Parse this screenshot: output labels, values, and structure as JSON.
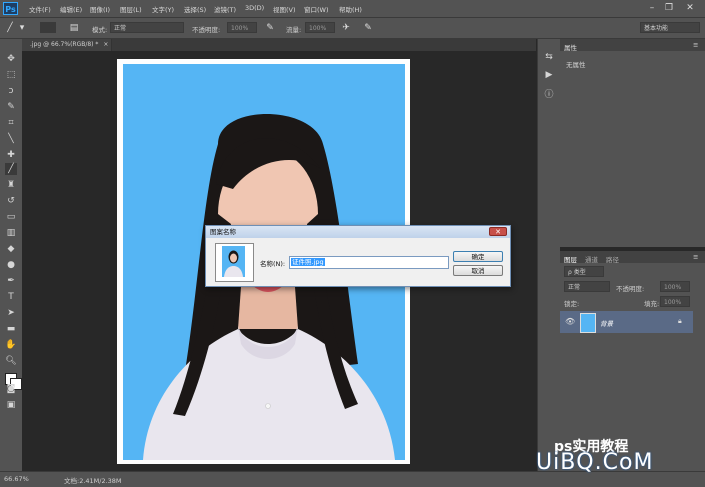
{
  "app": {
    "logo": "Ps"
  },
  "menu": [
    "文件(F)",
    "编辑(E)",
    "图像(I)",
    "图层(L)",
    "文字(Y)",
    "选择(S)",
    "滤镜(T)",
    "3D(D)",
    "视图(V)",
    "窗口(W)",
    "帮助(H)"
  ],
  "window_controls": {
    "minimize": "–",
    "restore": "❐",
    "close": "✕"
  },
  "options": {
    "mode_label": "模式:",
    "mode_value": "正常",
    "opacity_label": "不透明度:",
    "opacity_value": "100%",
    "flow_label": "流量:",
    "flow_value": "100%",
    "workspace": "基本功能"
  },
  "document": {
    "tab_title": ".jpg @ 66.7%(RGB/8) *",
    "tab_close": "×"
  },
  "properties": {
    "tab": "属性",
    "empty_text": "无属性"
  },
  "layers": {
    "tabs": [
      "图层",
      "通道",
      "路径"
    ],
    "filter_label": "ρ 类型",
    "blend_mode": "正常",
    "opacity_label": "不透明度:",
    "opacity_value": "100%",
    "lock_label": "锁定:",
    "fill_label": "填充:",
    "fill_value": "100%",
    "items": [
      {
        "name": "背景",
        "visible": true,
        "locked": true
      }
    ]
  },
  "status": {
    "zoom": "66.67%",
    "doc_info": "文档:2.41M/2.38M"
  },
  "dialog": {
    "title": "图案名称",
    "name_label": "名称(N):",
    "name_value": "证件照.jpg",
    "ok_label": "确定",
    "cancel_label": "取消",
    "close": "✕"
  },
  "watermark": {
    "brand_text": "UiBQ.CoM",
    "cn_text": "ps实用教程"
  },
  "colors": {
    "photo_bg": "#55b5f4",
    "panel": "#535353",
    "canvas": "#282828",
    "accent": "#31a8ff"
  }
}
